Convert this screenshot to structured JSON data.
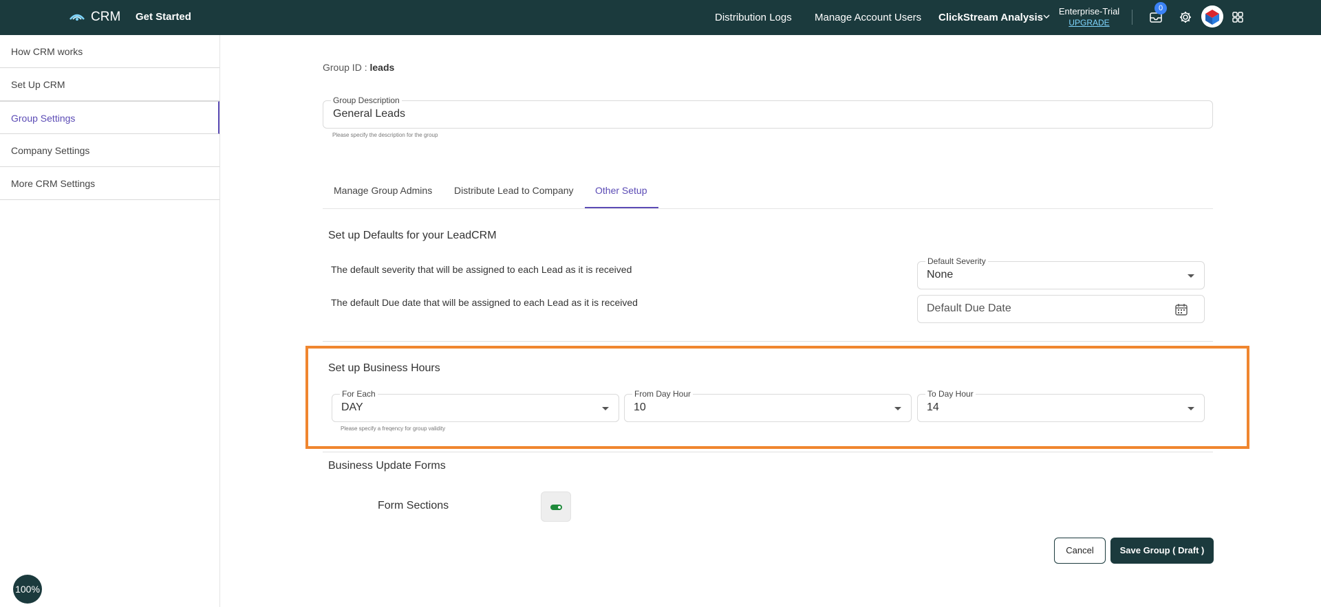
{
  "header": {
    "brand": "CRM",
    "get_started": "Get Started",
    "nav": [
      "Distribution Logs",
      "Manage Account Users",
      "ClickStream Analysis"
    ],
    "plan_name": "Enterprise-Trial",
    "plan_upgrade": "UPGRADE",
    "notification_count": "0",
    "icons": [
      "inbox-icon",
      "gear-icon",
      "avatar",
      "apps-grid-icon"
    ],
    "bar_color": "#1b3a3d"
  },
  "sidebar": {
    "items": [
      {
        "label": "How CRM works"
      },
      {
        "label": "Set Up CRM"
      },
      {
        "label": "Group Settings"
      },
      {
        "label": "Company Settings"
      },
      {
        "label": "More CRM Settings"
      }
    ],
    "active_index": 2,
    "accent": "#5b4bb5"
  },
  "zoom": "100%",
  "group": {
    "id_label": "Group ID :",
    "id_value": "leads",
    "description_label": "Group Description",
    "description_value": "General Leads",
    "description_helper": "Please specify the description for the group"
  },
  "tabs": [
    {
      "label": "Manage Group Admins"
    },
    {
      "label": "Distribute Lead to Company"
    },
    {
      "label": "Other Setup"
    }
  ],
  "defaults": {
    "title": "Set up Defaults for your LeadCRM",
    "severity_text": "The default severity that will be assigned to each Lead as it is received",
    "due_text": "The default Due date that will be assigned to each Lead as it is received",
    "severity_label": "Default Severity",
    "severity_value": "None",
    "due_placeholder": "Default Due Date"
  },
  "business_hours": {
    "title": "Set up Business Hours",
    "for_each_label": "For Each",
    "for_each_value": "DAY",
    "for_each_helper": "Please specify a freqency for group validity",
    "from_label": "From Day Hour",
    "from_value": "10",
    "to_label": "To Day Hour",
    "to_value": "14",
    "highlight_color": "#f0862f"
  },
  "business_forms": {
    "title": "Business Update Forms",
    "form_sections_label": "Form Sections",
    "toggle_on": true
  },
  "actions": {
    "cancel": "Cancel",
    "save": "Save Group ( Draft )"
  }
}
